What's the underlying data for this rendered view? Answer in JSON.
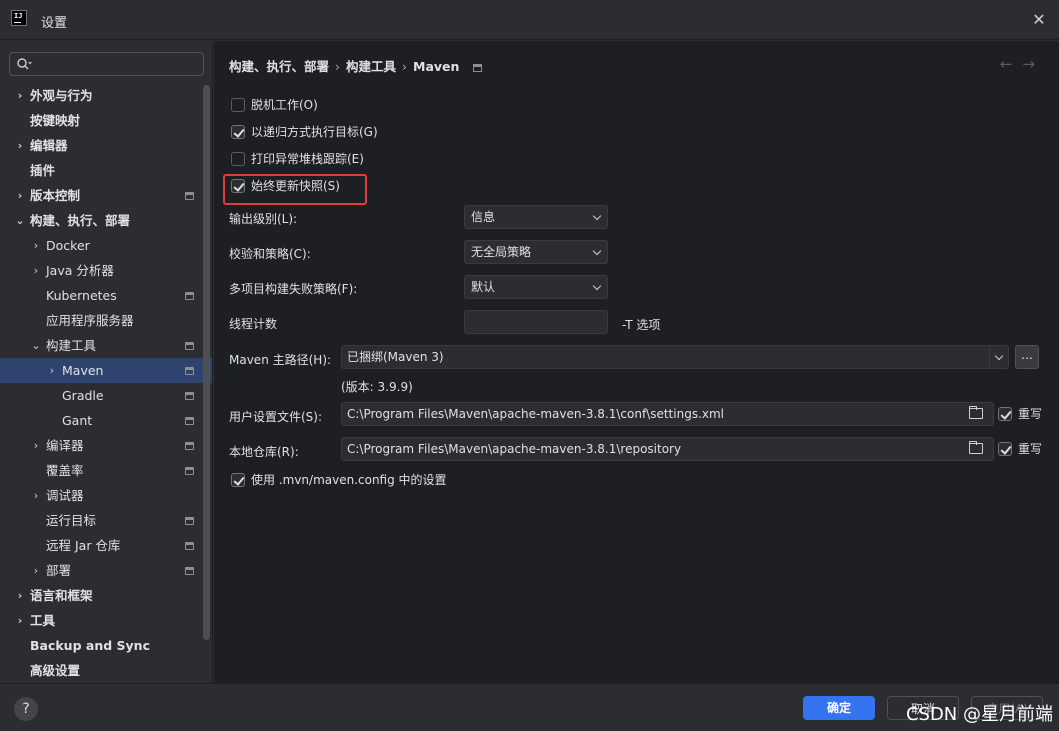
{
  "window": {
    "title": "设置",
    "icon_text": "IJ"
  },
  "search": {
    "placeholder": ""
  },
  "sidebar": {
    "items": [
      {
        "label": "外观与行为",
        "chevron": "›",
        "bold": true
      },
      {
        "label": "按键映射",
        "chevron": "",
        "bold": true
      },
      {
        "label": "编辑器",
        "chevron": "›",
        "bold": true
      },
      {
        "label": "插件",
        "chevron": "",
        "bold": true
      },
      {
        "label": "版本控制",
        "chevron": "›",
        "bold": true,
        "proj": true
      },
      {
        "label": "构建、执行、部署",
        "chevron": "⌄",
        "bold": true
      },
      {
        "label": "Docker",
        "chevron": "›"
      },
      {
        "label": "Java 分析器",
        "chevron": "›"
      },
      {
        "label": "Kubernetes",
        "chevron": "",
        "proj": true
      },
      {
        "label": "应用程序服务器",
        "chevron": ""
      },
      {
        "label": "构建工具",
        "chevron": "⌄",
        "proj": true
      },
      {
        "label": "Maven",
        "chevron": "›",
        "selected": true,
        "proj": true
      },
      {
        "label": "Gradle",
        "chevron": "",
        "proj": true
      },
      {
        "label": "Gant",
        "chevron": "",
        "proj": true
      },
      {
        "label": "编译器",
        "chevron": "›",
        "proj": true
      },
      {
        "label": "覆盖率",
        "chevron": "",
        "proj": true
      },
      {
        "label": "调试器",
        "chevron": "›"
      },
      {
        "label": "运行目标",
        "chevron": "",
        "proj": true
      },
      {
        "label": "远程 Jar 仓库",
        "chevron": "",
        "proj": true
      },
      {
        "label": "部署",
        "chevron": "›",
        "proj": true
      },
      {
        "label": "语言和框架",
        "chevron": "›",
        "bold": true
      },
      {
        "label": "工具",
        "chevron": "›",
        "bold": true
      },
      {
        "label": "Backup and Sync",
        "chevron": "",
        "bold": true
      },
      {
        "label": "高级设置",
        "chevron": "",
        "bold": true
      }
    ]
  },
  "breadcrumb": [
    "构建、执行、部署",
    "构建工具",
    "Maven"
  ],
  "nav": {
    "back": "←",
    "forward": "→"
  },
  "options": {
    "offline": {
      "label": "脱机工作(O)",
      "checked": false
    },
    "recursive": {
      "label": "以递归方式执行目标(G)",
      "checked": true
    },
    "stacktrace": {
      "label": "打印异常堆栈跟踪(E)",
      "checked": false
    },
    "snapshots": {
      "label": "始终更新快照(S)",
      "checked": true
    }
  },
  "form": {
    "output_level": {
      "label": "输出级别(L):",
      "value": "信息"
    },
    "checksum": {
      "label": "校验和策略(C):",
      "value": "无全局策略"
    },
    "failure": {
      "label": "多项目构建失败策略(F):",
      "value": "默认"
    },
    "threads": {
      "label": "线程计数",
      "value": "",
      "suffix": "-T 选项"
    },
    "home": {
      "label": "Maven 主路径(H):",
      "value": "已捆绑(Maven 3)",
      "browse": "...",
      "version": "(版本: 3.9.9)"
    },
    "settings_file": {
      "label": "用户设置文件(S):",
      "value": "C:\\Program Files\\Maven\\apache-maven-3.8.1\\conf\\settings.xml",
      "override": "重写",
      "override_checked": true
    },
    "local_repo": {
      "label": "本地仓库(R):",
      "value": "C:\\Program Files\\Maven\\apache-maven-3.8.1\\repository",
      "override": "重写",
      "override_checked": true
    },
    "mvn_config": {
      "label": "使用 .mvn/maven.config 中的设置",
      "checked": true
    }
  },
  "footer": {
    "help": "?",
    "ok": "确定",
    "cancel": "取消",
    "apply": "应用(A)"
  },
  "watermark": "CSDN @星月前端",
  "colors": {
    "accent": "#3574f0",
    "selection": "#2e436e",
    "highlight_box": "#e03c3c"
  }
}
